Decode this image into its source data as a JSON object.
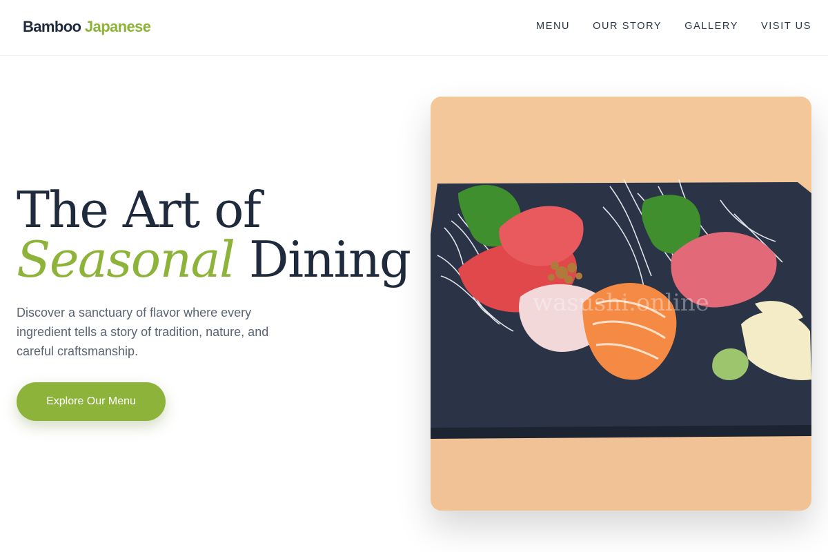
{
  "brand": {
    "name_part1": "Bamboo",
    "name_part2": "Japanese"
  },
  "nav": [
    {
      "label": "MENU"
    },
    {
      "label": "OUR STORY"
    },
    {
      "label": "GALLERY"
    },
    {
      "label": "VISIT US"
    }
  ],
  "hero": {
    "line1": "The Art of",
    "line2_italic": "Seasonal",
    "line2_rest": "Dining",
    "description": "Discover a sanctuary of flavor where every ingredient tells a story of tradition, nature, and careful craftsmanship.",
    "cta_label": "Explore Our Menu"
  },
  "image": {
    "watermark": "wasushi.online"
  },
  "colors": {
    "accent": "#8db33a",
    "text_dark": "#1f2a3d",
    "text_muted": "#5b6473"
  }
}
